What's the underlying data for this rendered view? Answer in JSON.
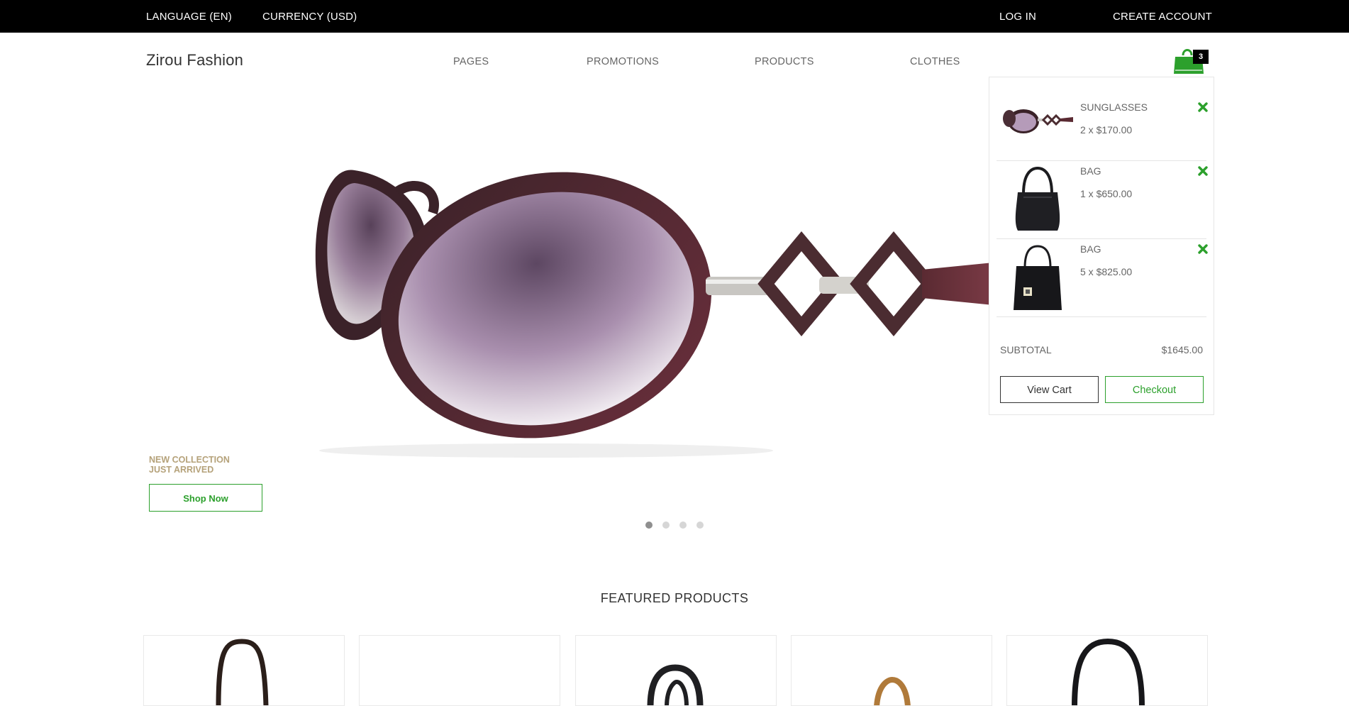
{
  "topbar": {
    "language": "LANGUAGE (EN)",
    "currency": "CURRENCY (USD)",
    "login": "LOG IN",
    "create_account": "CREATE ACCOUNT"
  },
  "header": {
    "logo": "Zirou Fashion",
    "nav": [
      "PAGES",
      "PROMOTIONS",
      "PRODUCTS",
      "CLOTHES"
    ],
    "cart_icon": "shopping-bag-icon",
    "cart_count": "3"
  },
  "hero": {
    "tag_line1": "NEW COLLECTION",
    "tag_line2": "JUST ARRIVED",
    "button": "Shop Now",
    "slides": 4,
    "active_slide": 1
  },
  "featured": {
    "title": "FEATURED PRODUCTS"
  },
  "mini_cart": {
    "items": [
      {
        "name": "SUNGLASSES",
        "qty_price": "2 x $170.00",
        "thumb": "sunglasses"
      },
      {
        "name": "BAG",
        "qty_price": "1 x $650.00",
        "thumb": "bag"
      },
      {
        "name": "BAG",
        "qty_price": "5 x $825.00",
        "thumb": "bag"
      }
    ],
    "remove_icon": "close-x-icon",
    "subtotal_label": "SUBTOTAL",
    "subtotal_value": "$1645.00",
    "view_cart": "View Cart",
    "checkout": "Checkout"
  },
  "colors": {
    "accent": "#2ca02c",
    "topbar_bg": "#000000",
    "tag_color": "#b5a27a"
  }
}
